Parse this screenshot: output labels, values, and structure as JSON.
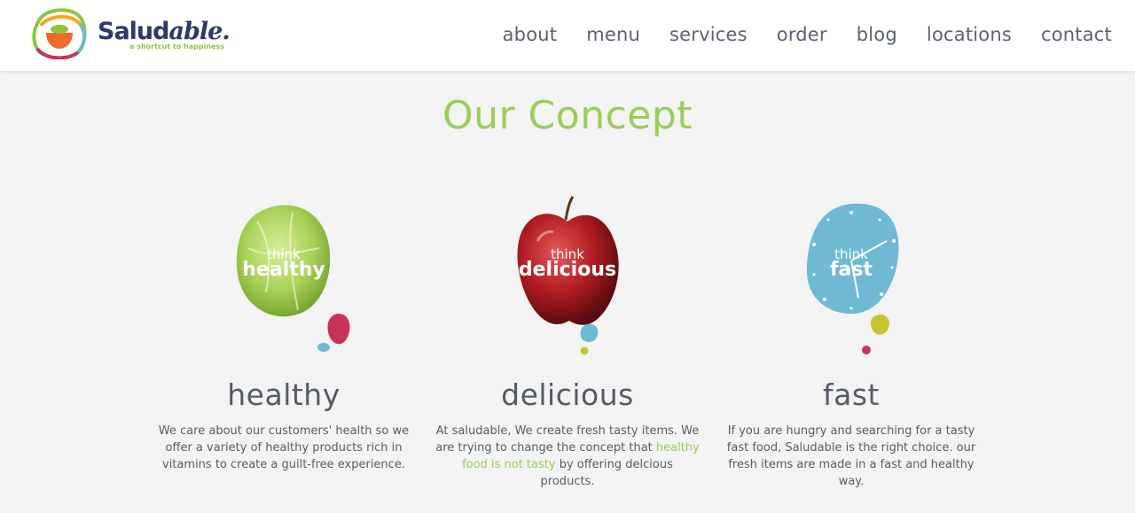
{
  "brand": {
    "name_bold": "Salud",
    "name_italic": "able.",
    "tagline": "a shortcut to happiness"
  },
  "nav": {
    "items": [
      {
        "label": "about"
      },
      {
        "label": "menu"
      },
      {
        "label": "services"
      },
      {
        "label": "order"
      },
      {
        "label": "blog"
      },
      {
        "label": "locations"
      },
      {
        "label": "contact"
      }
    ]
  },
  "page_title": "Our Concept",
  "concepts": [
    {
      "think_small": "think",
      "think_big": "healthy",
      "title": "healthy",
      "text": "We care about our customers' health so we offer a variety of healthy products rich in vitamins to create a guilt-free experience."
    },
    {
      "think_small": "think",
      "think_big": "delicious",
      "title": "delicious",
      "text_before": "At saludable, We create fresh tasty items. We are trying to change the concept that ",
      "text_link": "healthy food is not tasty",
      "text_after": " by offering delcious products."
    },
    {
      "think_small": "think",
      "think_big": "fast",
      "title": "fast",
      "text": "If you are hungry and searching for a tasty fast food, Saludable is the right choice. our fresh items are made in a fast and healthy way."
    }
  ],
  "colors": {
    "accent_green": "#9acd57",
    "brand_navy": "#2b3a6b",
    "dot_pink": "#c8325a",
    "dot_blue": "#6bbad6",
    "dot_yellow": "#c4c62e",
    "clock_blue": "#6fb9d4"
  },
  "icons": [
    "lettuce-icon",
    "apple-icon",
    "clock-icon"
  ]
}
